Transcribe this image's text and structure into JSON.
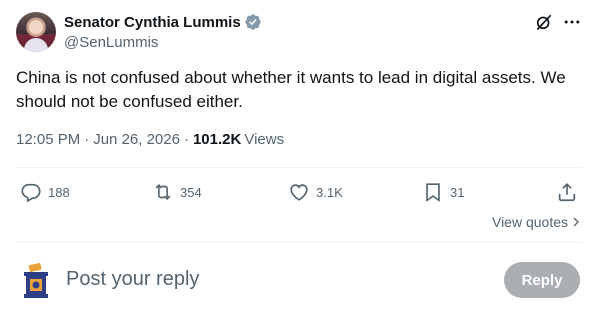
{
  "author": {
    "display_name": "Senator Cynthia Lummis",
    "handle": "@SenLummis",
    "verified": true,
    "verified_color": "#829aab"
  },
  "tweet": {
    "text": "China is not confused about whether it wants to lead in digital assets. We should not be confused either.",
    "time": "12:05 PM",
    "separator": "·",
    "date": "Jun 26, 2026",
    "views_count": "101.2K",
    "views_label": "Views"
  },
  "actions": {
    "replies": "188",
    "reposts": "354",
    "likes": "3.1K",
    "bookmarks": "31"
  },
  "view_quotes": "View quotes",
  "reply": {
    "placeholder": "Post your reply",
    "button_label": "Reply"
  },
  "colors": {
    "text_primary": "#0f1419",
    "text_secondary": "#536471",
    "divider": "#eff3f4",
    "reply_button_bg": "#8f9499"
  },
  "icons": {
    "verified": "verified-badge-icon",
    "grok": "grok-icon",
    "more": "more-icon",
    "reply": "reply-icon",
    "repost": "repost-icon",
    "like": "heart-icon",
    "bookmark": "bookmark-icon",
    "share": "share-icon",
    "chevron": "chevron-right-icon"
  }
}
